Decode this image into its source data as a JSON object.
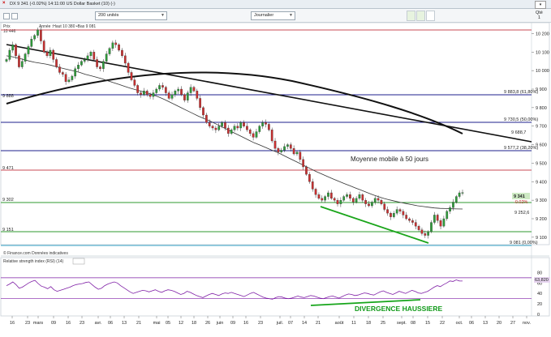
{
  "window": {
    "close_glyph": "×",
    "title": "DX  9 341 (-0.02%)  14:11:00 US Dollar Basket (10) (-)"
  },
  "toolbar": {
    "units": "200 unités",
    "period": "Journalier",
    "qte_line1": "Qté",
    "qte_line2": "1"
  },
  "legend": {
    "prix": "Prix",
    "scale_note": "10 446",
    "items": "Année  :Haut 10 380  •Bas 9 081"
  },
  "price_axis": [
    "10 200",
    "10 100",
    "10 000",
    "9 900",
    "9 800",
    "9 700",
    "9 600",
    "9 500",
    "9 400",
    "9 300",
    "9 200",
    "9 100"
  ],
  "level_labels": {
    "l9883": "9 883,8 (61,80%)",
    "l9730": "9 730,5 (50,00%)",
    "l9688": "9 688,7",
    "l9577": "9 577,2 (38,20%)",
    "l9081": "9 081 (0,00%)",
    "l9252": "9 252,6",
    "l9341": "9 341",
    "chg": "-0.02%",
    "left9888": "9 888",
    "left9471": "9 471",
    "left9302": "9 302",
    "left9151": "9 151"
  },
  "annotation_ma": "Moyenne mobile à 50 jours",
  "annotation_div": "DIVERGENCE HAUSSIERE",
  "source_note": "© Finance.com Données indicatives",
  "rsi": {
    "title": "Relative strength index (RSI) (14)",
    "axis": [
      "80",
      "60",
      "40",
      "20",
      "0"
    ],
    "last": "63,820",
    "overbought": 70,
    "oversold": 30
  },
  "date_axis": [
    {
      "t": "16",
      "x": 15
    },
    {
      "t": "23",
      "x": 34
    },
    {
      "t": "mars",
      "x": 47
    },
    {
      "t": "09",
      "x": 66
    },
    {
      "t": "16",
      "x": 84
    },
    {
      "t": "23",
      "x": 101
    },
    {
      "t": "avr.",
      "x": 121
    },
    {
      "t": "06",
      "x": 136
    },
    {
      "t": "13",
      "x": 153
    },
    {
      "t": "21",
      "x": 171
    },
    {
      "t": "mai",
      "x": 193
    },
    {
      "t": "05",
      "x": 207
    },
    {
      "t": "12",
      "x": 223
    },
    {
      "t": "18",
      "x": 239
    },
    {
      "t": "26",
      "x": 256
    },
    {
      "t": "juin",
      "x": 271
    },
    {
      "t": "09",
      "x": 287
    },
    {
      "t": "16",
      "x": 303
    },
    {
      "t": "23",
      "x": 321
    },
    {
      "t": "juil.",
      "x": 345
    },
    {
      "t": "07",
      "x": 358
    },
    {
      "t": "14",
      "x": 375
    },
    {
      "t": "21",
      "x": 392
    },
    {
      "t": "août",
      "x": 418
    },
    {
      "t": "11",
      "x": 436
    },
    {
      "t": "18",
      "x": 454
    },
    {
      "t": "25",
      "x": 472
    },
    {
      "t": "sept.",
      "x": 495
    },
    {
      "t": "08",
      "x": 509
    },
    {
      "t": "15",
      "x": 527
    },
    {
      "t": "22",
      "x": 545
    },
    {
      "t": "oct.",
      "x": 566
    },
    {
      "t": "06",
      "x": 581
    },
    {
      "t": "13",
      "x": 598
    },
    {
      "t": "20",
      "x": 615
    },
    {
      "t": "27",
      "x": 632
    },
    {
      "t": "nov.",
      "x": 649
    }
  ],
  "colors": {
    "up": "#2e9c3a",
    "down": "#c93030",
    "navy_line": "#1c1f8e",
    "red_line": "#c94b55",
    "green_line": "#2f9a2f",
    "cyan_line": "#3aa6c8",
    "rsi_line": "#7f1fa6",
    "div_line": "#16a51a"
  },
  "chart_data": {
    "type": "candlestick",
    "title": "DX US Dollar Basket",
    "y_unit": "points",
    "ylim": [
      9060,
      10250
    ],
    "horizontal_levels": [
      {
        "value": 10225,
        "color": "red"
      },
      {
        "value": 9883.8,
        "color": "navy",
        "label": "9 883,8 (61,80%)"
      },
      {
        "value": 9730.5,
        "color": "navy",
        "label": "9 730,5 (50,00%)"
      },
      {
        "value": 9577.2,
        "color": "navy",
        "label": "9 577,2 (38,20%)"
      },
      {
        "value": 9471,
        "color": "red",
        "label": "9 471"
      },
      {
        "value": 9302,
        "color": "green",
        "label": "9 302"
      },
      {
        "value": 9151,
        "color": "green",
        "label": "9 151"
      },
      {
        "value": 9081,
        "color": "cyan",
        "label": "9 081 (0,00%)"
      }
    ],
    "closes": [
      10060,
      10110,
      10140,
      10080,
      10020,
      10050,
      10090,
      10130,
      10170,
      10190,
      10220,
      10160,
      10100,
      10080,
      10110,
      10060,
      10020,
      9990,
      9980,
      9940,
      9950,
      9970,
      10010,
      10030,
      10050,
      10060,
      10080,
      10100,
      10060,
      10020,
      10010,
      10050,
      10090,
      10120,
      10150,
      10140,
      10110,
      10080,
      10040,
      9990,
      9950,
      9920,
      9880,
      9870,
      9890,
      9870,
      9860,
      9880,
      9900,
      9920,
      9910,
      9880,
      9850,
      9870,
      9890,
      9900,
      9870,
      9840,
      9880,
      9910,
      9890,
      9850,
      9800,
      9760,
      9720,
      9700,
      9690,
      9680,
      9700,
      9720,
      9690,
      9660,
      9680,
      9700,
      9690,
      9720,
      9700,
      9680,
      9660,
      9640,
      9670,
      9700,
      9720,
      9710,
      9680,
      9620,
      9580,
      9560,
      9570,
      9590,
      9600,
      9580,
      9550,
      9560,
      9520,
      9480,
      9440,
      9400,
      9360,
      9330,
      9310,
      9300,
      9320,
      9340,
      9310,
      9300,
      9280,
      9300,
      9320,
      9330,
      9310,
      9290,
      9310,
      9330,
      9300,
      9280,
      9270,
      9290,
      9310,
      9300,
      9280,
      9250,
      9230,
      9210,
      9230,
      9250,
      9240,
      9220,
      9200,
      9190,
      9180,
      9160,
      9140,
      9120,
      9110,
      9130,
      9180,
      9220,
      9190,
      9160,
      9200,
      9240,
      9260,
      9290,
      9320,
      9340,
      9341
    ],
    "ma50": [
      10080,
      10075,
      10068,
      10060,
      10052,
      10045,
      10040,
      10035,
      10028,
      10020,
      10012,
      10005,
      9998,
      9990,
      9980,
      9972,
      9964,
      9955,
      9945,
      9935,
      9925,
      9915,
      9905,
      9896,
      9888,
      9880,
      9870,
      9858,
      9845,
      9830,
      9815,
      9800,
      9785,
      9770,
      9755,
      9742,
      9730,
      9715,
      9700,
      9685,
      9670,
      9655,
      9640,
      9625,
      9610,
      9598,
      9585,
      9572,
      9560,
      9545,
      9530,
      9515,
      9500,
      9485,
      9470,
      9455,
      9442,
      9428,
      9415,
      9402,
      9390,
      9378,
      9366,
      9354,
      9342,
      9330,
      9320,
      9310,
      9302,
      9295,
      9288,
      9282,
      9276,
      9270,
      9266,
      9262,
      9258,
      9256,
      9255,
      9254,
      9253,
      9252.6
    ],
    "rsi": [
      55,
      58,
      62,
      57,
      50,
      52,
      56,
      60,
      63,
      65,
      59,
      54,
      52,
      49,
      53,
      47,
      44,
      46,
      48,
      50,
      52,
      55,
      57,
      58,
      59,
      61,
      62,
      57,
      52,
      48,
      50,
      55,
      58,
      60,
      62,
      60,
      55,
      51,
      47,
      43,
      40,
      42,
      44,
      46,
      45,
      43,
      45,
      47,
      44,
      42,
      45,
      47,
      46,
      44,
      41,
      38,
      40,
      44,
      42,
      39,
      36,
      34,
      32,
      35,
      38,
      40,
      38,
      36,
      39,
      41,
      40,
      42,
      40,
      38,
      36,
      34,
      37,
      40,
      42,
      39,
      36,
      33,
      31,
      30,
      29,
      32,
      34,
      33,
      31,
      30,
      31,
      33,
      35,
      33,
      32,
      34,
      36,
      35,
      33,
      31,
      30,
      32,
      34,
      35,
      33,
      31,
      34,
      37,
      39,
      38,
      36,
      37,
      39,
      41,
      40,
      38,
      37,
      40,
      43,
      45,
      42,
      40,
      38,
      41,
      44,
      42,
      40,
      43,
      46,
      44,
      41,
      40,
      42,
      44,
      48,
      52,
      55,
      53,
      57,
      60,
      64,
      63,
      66,
      64,
      63.82
    ],
    "rsi_levels": [
      70,
      30
    ]
  }
}
